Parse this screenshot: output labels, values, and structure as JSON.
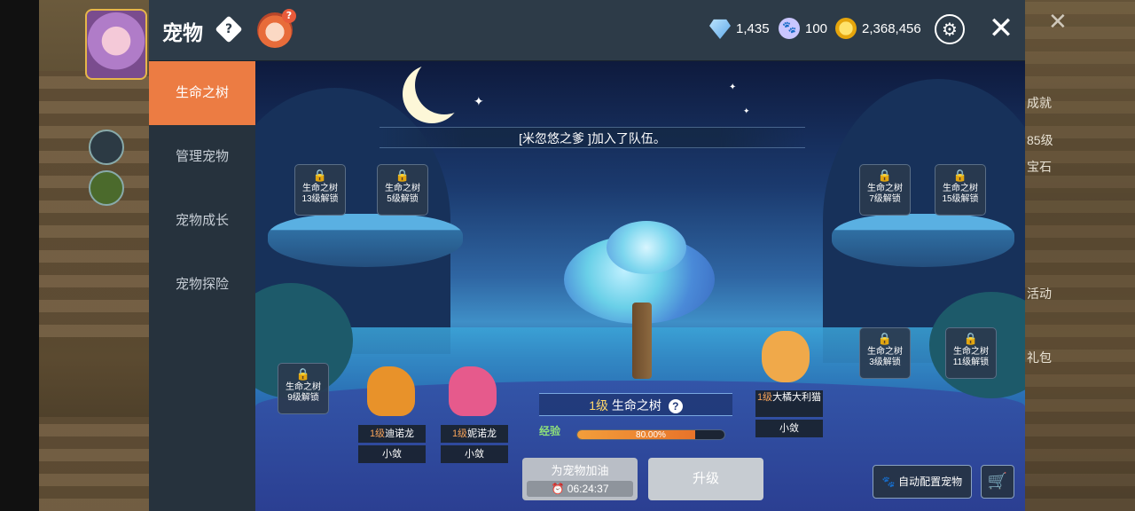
{
  "header": {
    "title": "宠物",
    "help_icon": "?",
    "mascot_badge": "?"
  },
  "currencies": [
    {
      "icon": "diamond-icon",
      "value": "1,435"
    },
    {
      "icon": "paw-coin-icon",
      "value": "100"
    },
    {
      "icon": "gold-coin-icon",
      "value": "2,368,456"
    }
  ],
  "close_label": "✕",
  "sidebar": {
    "items": [
      {
        "label": "生命之树",
        "active": true
      },
      {
        "label": "管理宠物",
        "active": false
      },
      {
        "label": "宠物成长",
        "active": false
      },
      {
        "label": "宠物探险",
        "active": false
      }
    ]
  },
  "notice": "[米忽悠之爹 ]加入了队伍。",
  "locked_slots": [
    {
      "line1": "生命之树",
      "line2": "13级解锁"
    },
    {
      "line1": "生命之树",
      "line2": "5级解锁"
    },
    {
      "line1": "生命之树",
      "line2": "7级解锁"
    },
    {
      "line1": "生命之树",
      "line2": "15级解锁"
    },
    {
      "line1": "生命之树",
      "line2": "9级解锁"
    },
    {
      "line1": "生命之树",
      "line2": "3级解锁"
    },
    {
      "line1": "生命之树",
      "line2": "11级解锁"
    }
  ],
  "pets": [
    {
      "level": "1级",
      "name": "迪诺龙",
      "role": "小敛",
      "color": "#e8922a"
    },
    {
      "level": "1级",
      "name": "妮诺龙",
      "role": "小敛",
      "color": "#e65a8c"
    },
    {
      "level": "1级",
      "name": "大橘大利猫",
      "role": "小敛",
      "color": "#f0a94a"
    }
  ],
  "tree": {
    "level": "1级",
    "name": "生命之树",
    "exp_label": "经验",
    "exp_text": "80.00%",
    "exp_fraction": 0.8
  },
  "buttons": {
    "boost_label": "为宠物加油",
    "boost_timer": "06:24:37",
    "upgrade_label": "升级",
    "auto_label": "自动配置宠物"
  },
  "game_side": {
    "labels": [
      "成就",
      "85级",
      "宝石",
      "活动",
      "礼包"
    ]
  }
}
